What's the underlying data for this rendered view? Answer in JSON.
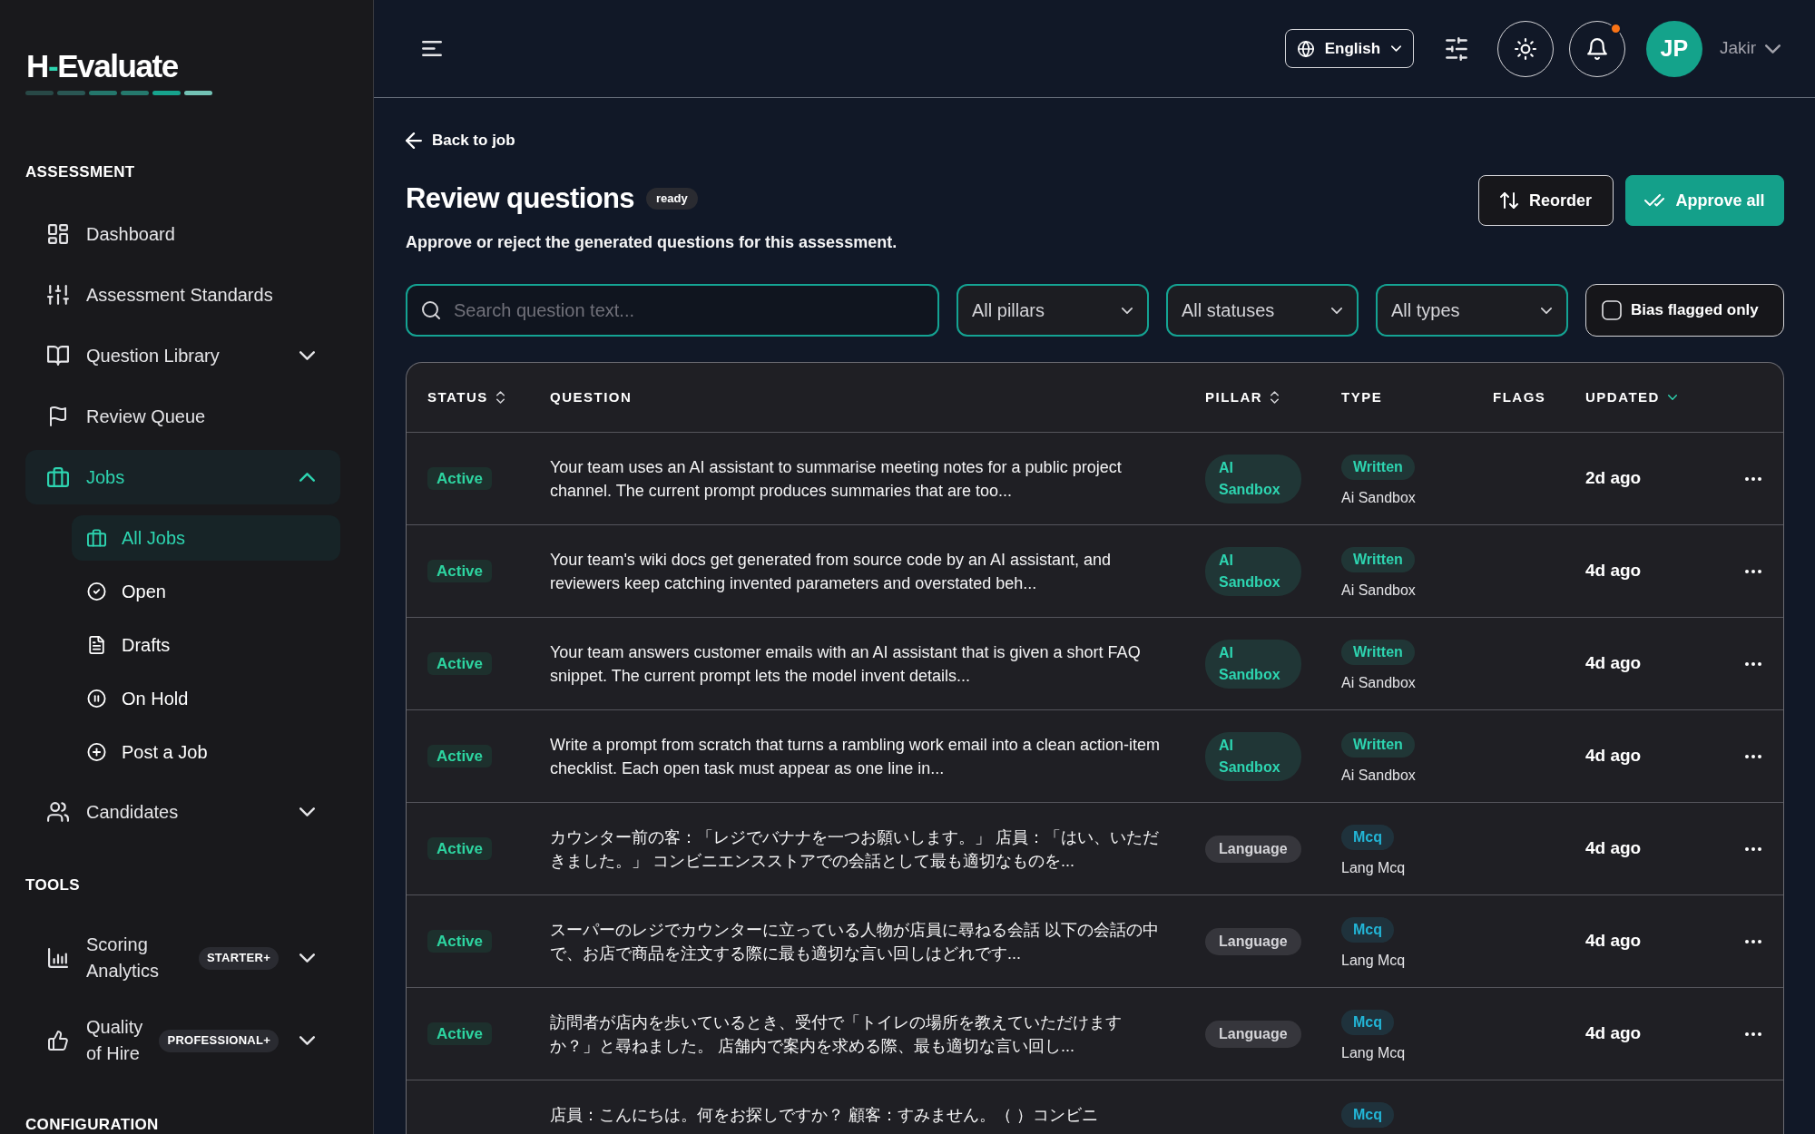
{
  "sidebar": {
    "logo": {
      "lead": "H",
      "dash": "-",
      "rest": "Evaluate"
    },
    "sections": [
      {
        "title": "ASSESSMENT",
        "items": [
          {
            "kind": "link",
            "label": "Dashboard",
            "selected": false
          },
          {
            "kind": "link",
            "label": "Assessment Standards",
            "selected": false
          },
          {
            "kind": "group",
            "label": "Question Library",
            "selected": false,
            "expanded": false
          },
          {
            "kind": "link",
            "label": "Review Queue",
            "selected": false
          },
          {
            "kind": "group",
            "label": "Jobs",
            "selected": true,
            "expanded": true,
            "children": [
              {
                "label": "All Jobs",
                "selected": true
              },
              {
                "label": "Open",
                "selected": false
              },
              {
                "label": "Drafts",
                "selected": false
              },
              {
                "label": "On Hold",
                "selected": false
              },
              {
                "label": "Post a Job",
                "selected": false
              }
            ]
          },
          {
            "kind": "group",
            "label": "Candidates",
            "selected": false,
            "expanded": false
          }
        ]
      },
      {
        "title": "TOOLS",
        "items": [
          {
            "kind": "group",
            "label": "Scoring Analytics",
            "badge": "STARTER+",
            "selected": false,
            "expanded": false
          },
          {
            "kind": "group",
            "label": "Quality of Hire",
            "badge": "PROFESSIONAL+",
            "selected": false,
            "expanded": false
          }
        ]
      },
      {
        "title": "CONFIGURATION"
      }
    ]
  },
  "header": {
    "language": "English",
    "notifications": {
      "unread": true
    },
    "user": {
      "initials": "JP",
      "name": "Jakir"
    }
  },
  "page": {
    "back_link": "Back to job",
    "title": "Review questions",
    "status_badge": "ready",
    "subtitle": "Approve or reject the generated questions for this assessment.",
    "actions": [
      {
        "label": "Reorder",
        "kind": "secondary"
      },
      {
        "label": "Approve all",
        "kind": "primary"
      }
    ]
  },
  "filters": {
    "search": {
      "placeholder": "Search question text..."
    },
    "selects": [
      {
        "value": "All pillars"
      },
      {
        "value": "All statuses"
      },
      {
        "value": "All types"
      }
    ],
    "bias_flagged": {
      "label": "Bias flagged only",
      "checked": false
    }
  },
  "table": {
    "columns": [
      {
        "label": "STATUS",
        "sortable": true,
        "sorted": false
      },
      {
        "label": "QUESTION",
        "sortable": false,
        "sorted": false
      },
      {
        "label": "PILLAR",
        "sortable": true,
        "sorted": false
      },
      {
        "label": "TYPE",
        "sortable": false,
        "sorted": false
      },
      {
        "label": "FLAGS",
        "sortable": false,
        "sorted": false
      },
      {
        "label": "UPDATED",
        "sortable": true,
        "sorted": true
      }
    ],
    "rows": [
      {
        "status": "Active",
        "question": "Your team uses an AI assistant to summarise meeting notes for a public project channel. The current prompt produces summaries that are too...",
        "pillar": {
          "label": "AI Sandbox",
          "color": "#2dd4b0"
        },
        "type": {
          "badge": "Written",
          "color": "#2dd4b0",
          "label": "Ai Sandbox"
        },
        "updated": "2d ago"
      },
      {
        "status": "Active",
        "question": "Your team's wiki docs get generated from source code by an AI assistant, and reviewers keep catching invented parameters and overstated beh...",
        "pillar": {
          "label": "AI Sandbox",
          "color": "#2dd4b0"
        },
        "type": {
          "badge": "Written",
          "color": "#2dd4b0",
          "label": "Ai Sandbox"
        },
        "updated": "4d ago"
      },
      {
        "status": "Active",
        "question": "Your team answers customer emails with an AI assistant that is given a short FAQ snippet. The current prompt lets the model invent details...",
        "pillar": {
          "label": "AI Sandbox",
          "color": "#2dd4b0"
        },
        "type": {
          "badge": "Written",
          "color": "#2dd4b0",
          "label": "Ai Sandbox"
        },
        "updated": "4d ago"
      },
      {
        "status": "Active",
        "question": "Write a prompt from scratch that turns a rambling work email into a clean action-item checklist. Each open task must appear as one line in...",
        "pillar": {
          "label": "AI Sandbox",
          "color": "#2dd4b0"
        },
        "type": {
          "badge": "Written",
          "color": "#2dd4b0",
          "label": "Ai Sandbox"
        },
        "updated": "4d ago"
      },
      {
        "status": "Active",
        "question": "カウンター前の客：「レジでバナナを一つお願いします。」 店員：「はい、いただきました。」 コンビニエンスストアでの会話として最も適切なものを...",
        "pillar": {
          "label": "Language",
          "color": "#d4d4d8"
        },
        "type": {
          "badge": "Mcq",
          "color": "#22b5d6",
          "label": "Lang Mcq"
        },
        "updated": "4d ago"
      },
      {
        "status": "Active",
        "question": "スーパーのレジでカウンターに立っている人物が店員に尋ねる会話 以下の会話の中で、お店で商品を注文する際に最も適切な言い回しはどれです...",
        "pillar": {
          "label": "Language",
          "color": "#d4d4d8"
        },
        "type": {
          "badge": "Mcq",
          "color": "#22b5d6",
          "label": "Lang Mcq"
        },
        "updated": "4d ago"
      },
      {
        "status": "Active",
        "question": "訪問者が店内を歩いているとき、受付で「トイレの場所を教えていただけますか？」と尋ねました。 店舗内で案内を求める際、最も適切な言い回し...",
        "pillar": {
          "label": "Language",
          "color": "#d4d4d8"
        },
        "type": {
          "badge": "Mcq",
          "color": "#22b5d6",
          "label": "Lang Mcq"
        },
        "updated": "4d ago"
      },
      {
        "question": "店員：こんにちは。何をお探しですか？ 顧客：すみません。（ ）コンビニ",
        "type": {
          "badge": "Mcq",
          "color": "#22b5d6"
        }
      }
    ]
  }
}
